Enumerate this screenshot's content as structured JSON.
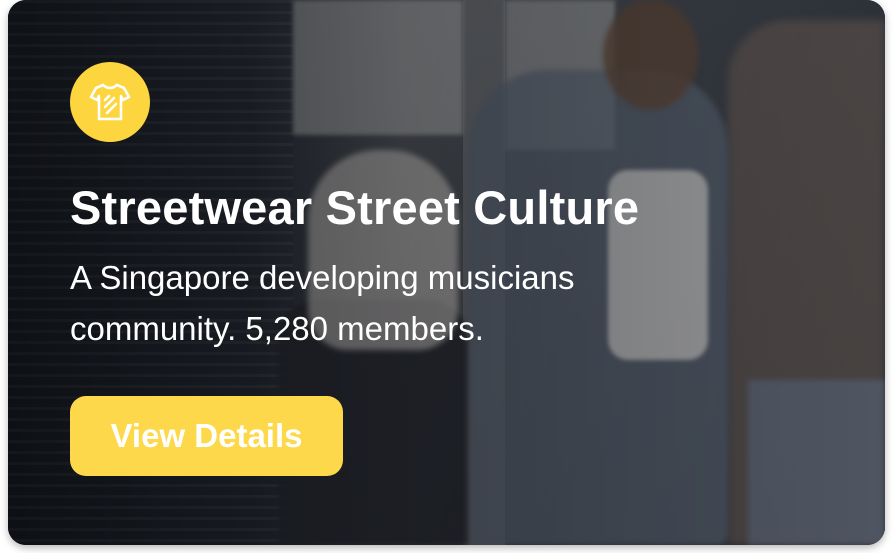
{
  "card": {
    "title": "Streetwear Street Culture",
    "description": "A Singapore developing musicians community. 5,280 members.",
    "icon": "tshirt-icon",
    "button_label": "View Details"
  },
  "colors": {
    "accent": "#fcd53f",
    "button": "#fdd84a",
    "text": "#ffffff"
  }
}
